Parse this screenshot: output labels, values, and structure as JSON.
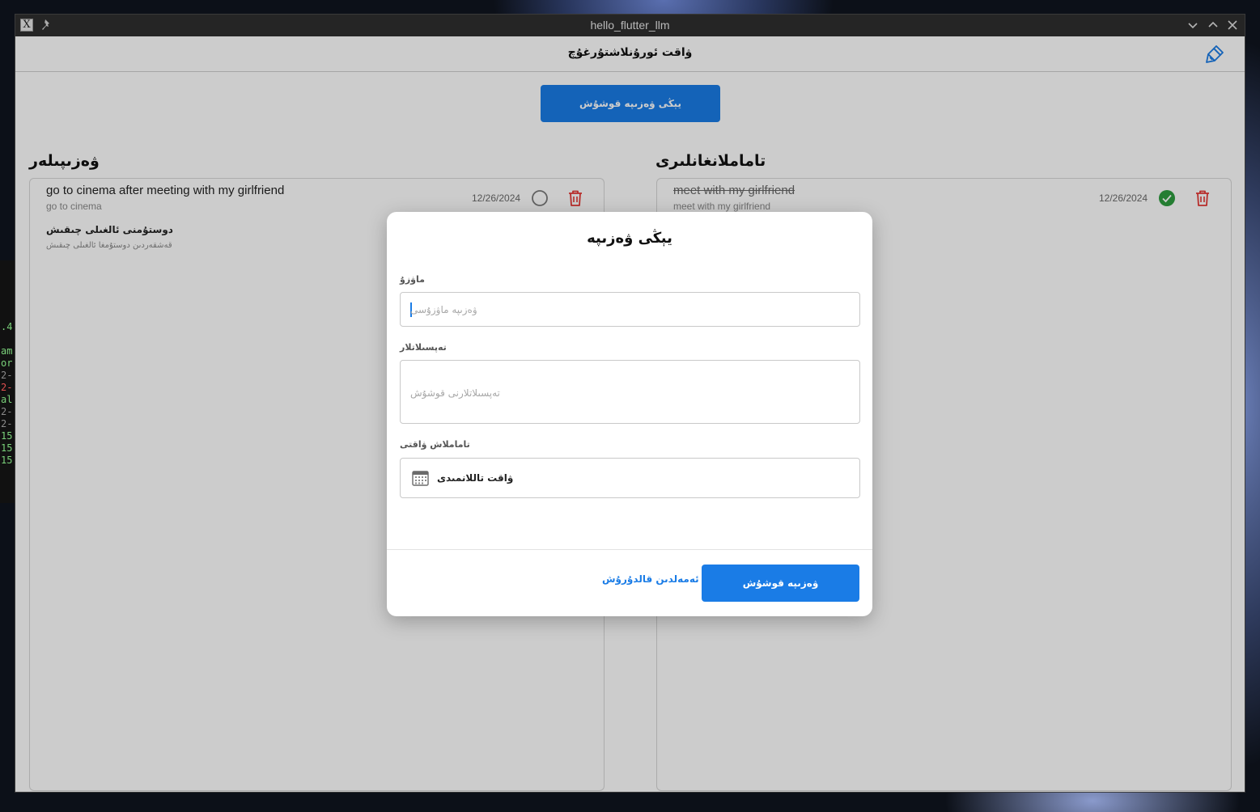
{
  "window": {
    "title": "hello_flutter_llm"
  },
  "appbar": {
    "title": "ۋاقت ئورۇنلاشتۇرغۇچ"
  },
  "add_button_label": "يېڭى ۋەزىپە قوشۇش",
  "pending": {
    "heading": "ۋەزىپىلەر",
    "tasks": [
      {
        "title": "go to cinema after meeting with my girlfriend",
        "description": "go to cinema",
        "date": "12/26/2024",
        "completed": false
      },
      {
        "title": "دوستۇمنى ئالغىلى چىقىش",
        "description": "قەشقەردىن دوستۇمغا ئالغىلى چىقىش",
        "date": "",
        "completed": false
      }
    ]
  },
  "completed": {
    "heading": "تاماملانغانلىرى",
    "tasks": [
      {
        "title": "meet with my girlfriend",
        "description": "meet with my girlfriend",
        "date": "12/26/2024",
        "completed": true
      }
    ]
  },
  "dialog": {
    "title": "يېڭى ۋەزىپە",
    "title_label": "ماۋزۇ",
    "title_placeholder": "ۋەزىپە ماۋزۇسى",
    "description_label": "تەپسىلاتلار",
    "description_placeholder": "تەپسىلاتلارنى قوشۇش",
    "due_label": "تاماملاش ۋاقتى",
    "due_value": "ۋاقت تاللانمىدى",
    "cancel_label": "ئەمەلدىن قالدۇرۇش",
    "submit_label": "ۋەزىپە قوشۇش"
  },
  "terminal": {
    "lines": [
      ".4",
      "am",
      "or",
      "2-",
      "2-",
      "al",
      "2-",
      "2-",
      "15",
      "15",
      "15"
    ]
  },
  "colors": {
    "primary": "#1a7ce6",
    "delete": "#e53935",
    "done": "#2e9d3f"
  }
}
